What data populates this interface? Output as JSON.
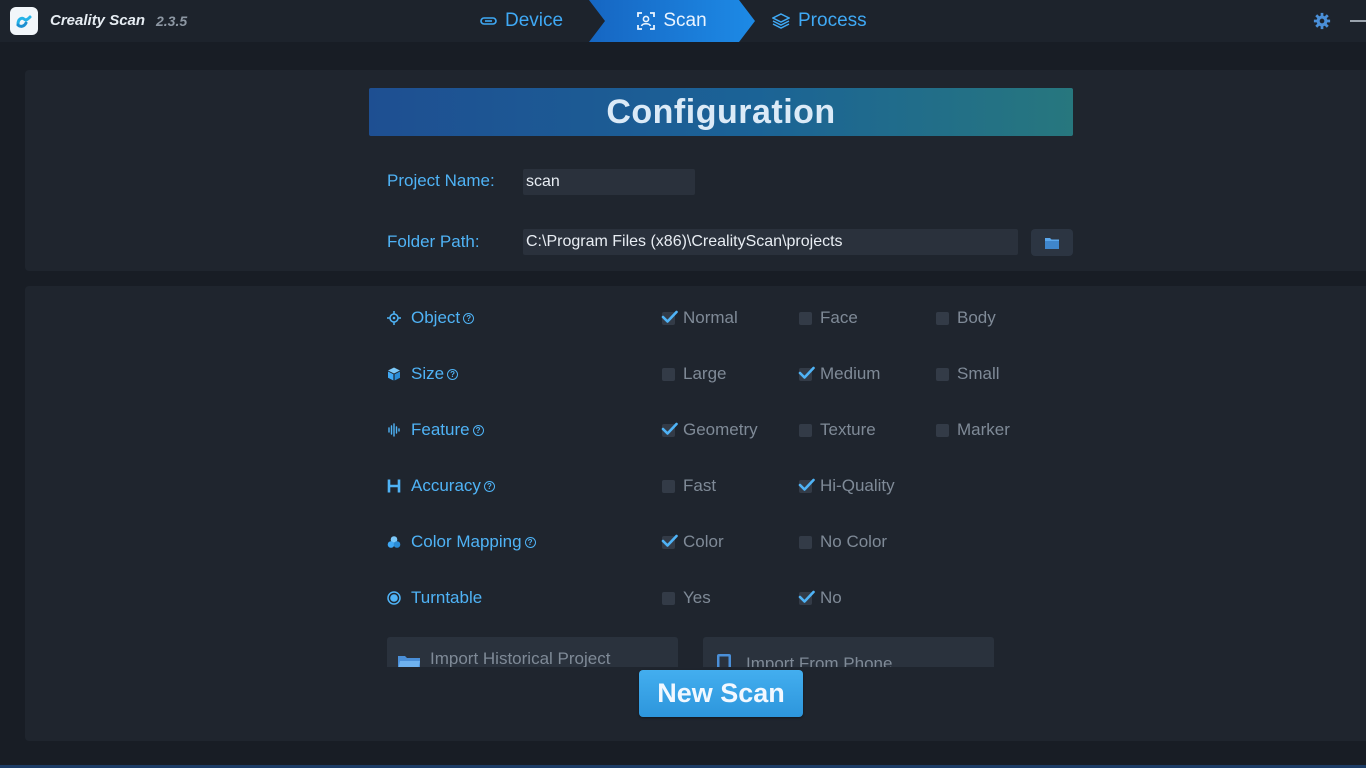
{
  "app": {
    "title": "Creality Scan",
    "version": "2.3.5"
  },
  "nav": {
    "device": "Device",
    "scan": "Scan",
    "process": "Process"
  },
  "config": {
    "heading": "Configuration",
    "project_name_label": "Project Name:",
    "project_name_value": "scan",
    "folder_path_label": "Folder Path:",
    "folder_path_value": "C:\\Program Files (x86)\\CrealityScan\\projects"
  },
  "options": {
    "object": {
      "label": "Object",
      "choices": [
        {
          "label": "Normal",
          "checked": true
        },
        {
          "label": "Face",
          "checked": false
        },
        {
          "label": "Body",
          "checked": false
        }
      ]
    },
    "size": {
      "label": "Size",
      "choices": [
        {
          "label": "Large",
          "checked": false
        },
        {
          "label": "Medium",
          "checked": true
        },
        {
          "label": "Small",
          "checked": false
        }
      ]
    },
    "feature": {
      "label": "Feature",
      "choices": [
        {
          "label": "Geometry",
          "checked": true
        },
        {
          "label": "Texture",
          "checked": false
        },
        {
          "label": "Marker",
          "checked": false
        }
      ]
    },
    "accuracy": {
      "label": "Accuracy",
      "choices": [
        {
          "label": "Fast",
          "checked": false
        },
        {
          "label": "Hi-Quality",
          "checked": true
        }
      ]
    },
    "color": {
      "label": "Color Mapping",
      "choices": [
        {
          "label": "Color",
          "checked": true
        },
        {
          "label": "No Color",
          "checked": false
        }
      ]
    },
    "turntable": {
      "label": "Turntable",
      "choices": [
        {
          "label": "Yes",
          "checked": false
        },
        {
          "label": "No",
          "checked": true
        }
      ]
    }
  },
  "buttons": {
    "import_history": "Import Historical Project",
    "import_phone": "Import From Phone",
    "new_scan": "New Scan"
  },
  "colors": {
    "accent": "#4fb3f6",
    "active_tab": "#1d8ae6",
    "background": "#181d25",
    "panel": "#1f252e"
  }
}
